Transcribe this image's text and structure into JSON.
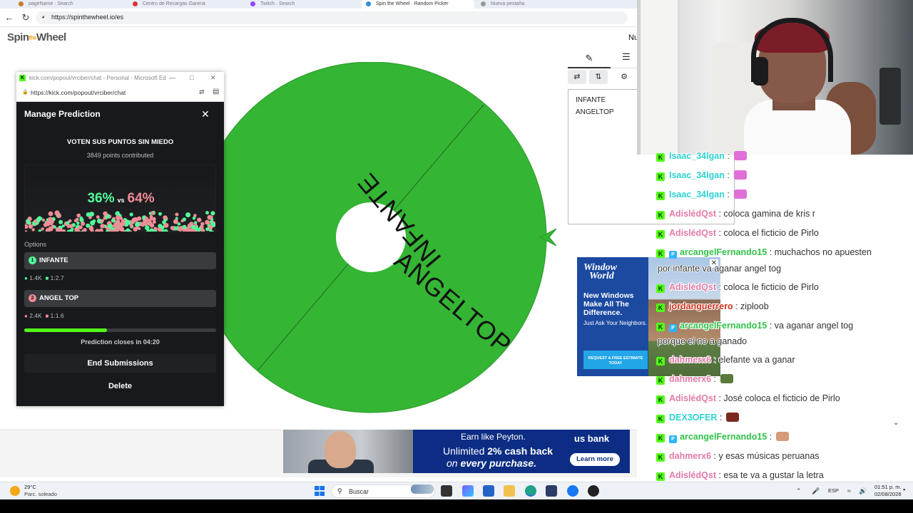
{
  "browser": {
    "tabs": [
      {
        "label": "pageName · Search",
        "color": "#c77d2e"
      },
      {
        "label": "Centro de Recargas Garena",
        "color": "#d33"
      },
      {
        "label": "Twitch · Search",
        "color": "#9146ff"
      },
      {
        "label": "Spin the Wheel · Random Picker",
        "color": "#2e8de0"
      },
      {
        "label": "Nueva pestaña",
        "color": "#999"
      }
    ],
    "url": "https://spinthewheel.io/es"
  },
  "wheel_page": {
    "logo_part1": "Spin",
    "logo_part2": "the",
    "logo_part3": "Wheel",
    "corner_label": "Nu",
    "wheel_color": "#34b534",
    "segments": [
      "INFANTE",
      "ANGELTOP"
    ],
    "entries": [
      "INFANTE",
      "ANGELTOP"
    ]
  },
  "popout": {
    "window_title": "kick.com/popout/vrciber/chat - Personal - Microsoft Edge",
    "url": "https://kick.com/popout/vrciber/chat",
    "panel_title": "Manage Prediction",
    "question": "VOTEN SUS PUNTOS SIN MIEDO",
    "points_contributed": "3849 points contributed",
    "percent_a": "36%",
    "vs": "vs",
    "percent_b": "64%",
    "options_label": "Options",
    "options": [
      {
        "num": "1",
        "label": "INFANTE",
        "users": "1.4K",
        "ratio": "1:2.7",
        "color": "#53fc9a"
      },
      {
        "num": "2",
        "label": "ANGEL TOP",
        "users": "2.4K",
        "ratio": "1:1.6",
        "color": "#f08c96"
      }
    ],
    "progress_fraction": 0.43,
    "closes_text": "Prediction closes in 04:20",
    "end_label": "End Submissions",
    "delete_label": "Delete"
  },
  "ad_banner": {
    "earn": "Earn like Peyton.",
    "line2_prefix": "Unlimited ",
    "line2_bold": "2% cash back",
    "line3_prefix": "on ",
    "line3_em": "every purchase.",
    "brand": "us bank",
    "cta": "Learn more"
  },
  "window_ad": {
    "logo_line1": "Window",
    "logo_line2": "World",
    "headline": "New Windows Make All The Difference.",
    "sub": "Just Ask Your Neighbors.",
    "cta": "REQUEST A FREE ESTIMATE TODAY"
  },
  "chat": {
    "lines": [
      {
        "user": "Isaac_34lgan",
        "msg": ":",
        "color": "#2fd3d3",
        "emote": "#e070d8",
        "partner": false
      },
      {
        "user": "Isaac_34lgan",
        "msg": ":",
        "color": "#2fd3d3",
        "emote": "#e070d8",
        "partner": false
      },
      {
        "user": "Isaac_34lgan",
        "msg": ":",
        "color": "#2fd3d3",
        "emote": "#e070d8",
        "partner": false
      },
      {
        "user": "AdislédQst",
        "msg": ": coloca gamina de kris r",
        "color": "#e47aa8",
        "emote": "",
        "partner": false
      },
      {
        "user": "AdislédQst",
        "msg": ": coloca el ficticio de Pirlo",
        "color": "#e47aa8",
        "emote": "",
        "partner": false
      },
      {
        "user": "arcangelFernando15",
        "msg": ": muchachos no apuesten",
        "color": "#33c24a",
        "emote": "",
        "partner": true
      },
      {
        "user": "AdislédQst",
        "msg": ": coloca le ficticio de Pirlo",
        "color": "#e47aa8",
        "emote": "",
        "partner": false
      },
      {
        "user": "jordanguerrero",
        "msg": ": ziploob",
        "color": "#d0321e",
        "emote": "",
        "partner": false
      },
      {
        "user": "arcangelFernando15",
        "msg": ": va aganar angel tog",
        "color": "#33c24a",
        "emote": "",
        "partner": true
      },
      {
        "user": "dahmerx6",
        "msg": ": elefante va a ganar",
        "color": "#e47aa8",
        "emote": "",
        "partner": false
      },
      {
        "user": "dahmerx6",
        "msg": ":",
        "color": "#e47aa8",
        "emote": "#5a7a3a",
        "partner": false
      },
      {
        "user": "AdislédQst",
        "msg": ": José coloca el ficticio de Pirlo",
        "color": "#e47aa8",
        "emote": "",
        "partner": false
      },
      {
        "user": "DEX3OFER",
        "msg": ":",
        "color": "#2fd3d3",
        "emote": "#7a2a1e",
        "partner": false
      },
      {
        "user": "arcangelFernando15",
        "msg": ":",
        "color": "#33c24a",
        "emote": "#d49a7a",
        "partner": true
      },
      {
        "user": "dahmerx6",
        "msg": ": y esas músicas peruanas",
        "color": "#e47aa8",
        "emote": "",
        "partner": false
      },
      {
        "user": "AdislédQst",
        "msg": ": esa te va a gustar la letra",
        "color": "#e47aa8",
        "emote": "",
        "partner": false
      }
    ],
    "wrap_1": "por infante va aganar angel tog",
    "wrap_2": "porque el no a ganado"
  },
  "taskbar": {
    "temp": "29°C",
    "weather": "Parc. soleado",
    "search_placeholder": "Buscar",
    "lang": "ESP",
    "time": "01:51 p. m.",
    "date": "02/08/2026"
  }
}
